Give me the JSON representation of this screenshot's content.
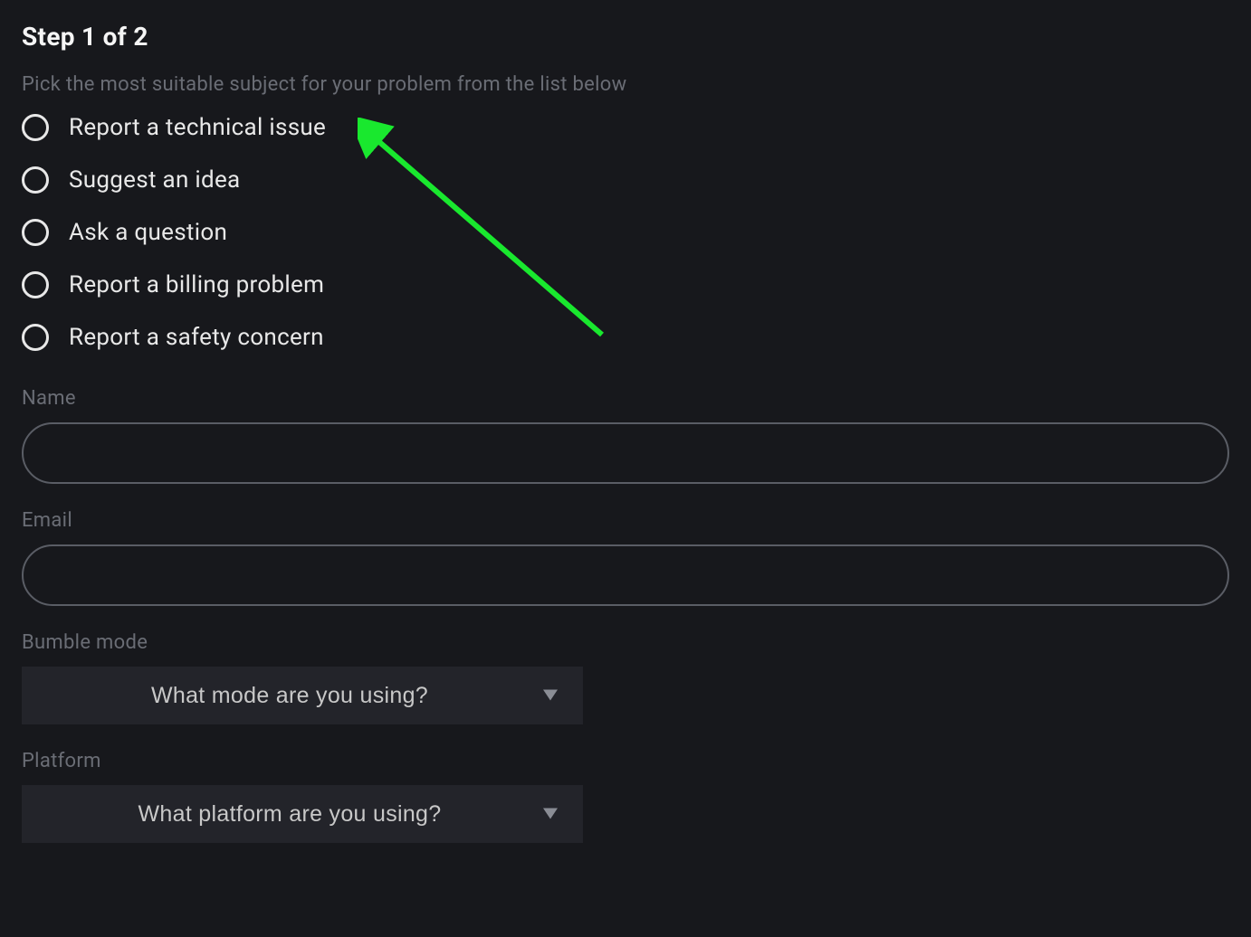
{
  "header": {
    "step_title": "Step 1 of 2",
    "instruction": "Pick the most suitable subject for your problem from the list below"
  },
  "subject_options": [
    {
      "id": "technical",
      "label": "Report a technical issue"
    },
    {
      "id": "idea",
      "label": "Suggest an idea"
    },
    {
      "id": "question",
      "label": "Ask a question"
    },
    {
      "id": "billing",
      "label": "Report a billing problem"
    },
    {
      "id": "safety",
      "label": "Report a safety concern"
    }
  ],
  "fields": {
    "name": {
      "label": "Name",
      "value": ""
    },
    "email": {
      "label": "Email",
      "value": ""
    },
    "mode": {
      "label": "Bumble mode",
      "placeholder": "What mode are you using?"
    },
    "platform": {
      "label": "Platform",
      "placeholder": "What platform are you using?"
    }
  },
  "annotation": {
    "arrow_color": "#19e82e"
  }
}
